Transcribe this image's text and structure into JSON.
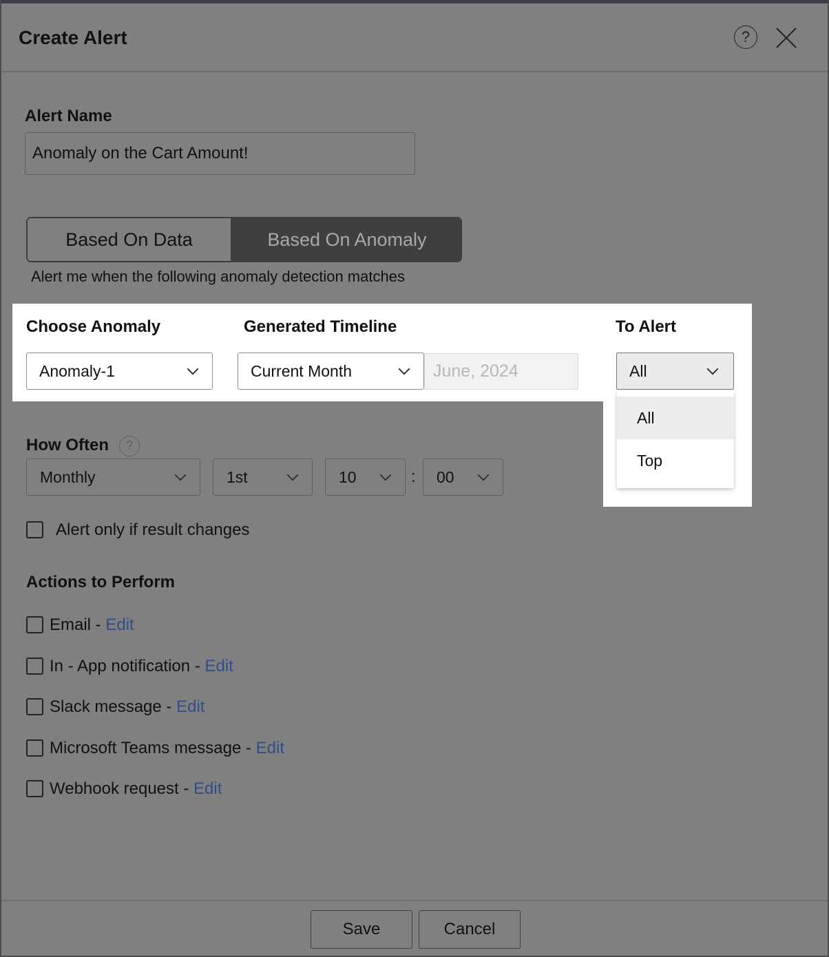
{
  "dialog": {
    "title": "Create Alert",
    "help_icon": "?"
  },
  "alert_name": {
    "label": "Alert Name",
    "value": "Anomaly on the Cart Amount!"
  },
  "mode_toggle": {
    "options": [
      "Based On Data",
      "Based On Anomaly"
    ],
    "selected": "Based On Anomaly"
  },
  "description": "Alert me when the following anomaly detection matches",
  "choose_anomaly": {
    "label": "Choose Anomaly",
    "value": "Anomaly-1"
  },
  "generated_timeline": {
    "label": "Generated Timeline",
    "value": "Current Month",
    "period_placeholder": "June, 2024"
  },
  "to_alert": {
    "label": "To Alert",
    "value": "All",
    "options": [
      "All",
      "Top"
    ],
    "highlighted": "All"
  },
  "how_often": {
    "label": "How Often",
    "help_icon": "?",
    "frequency": "Monthly",
    "day": "1st",
    "hour": "10",
    "separator": ":",
    "minute": "00"
  },
  "alert_on_change": {
    "label": "Alert only if result changes",
    "checked": false
  },
  "actions": {
    "heading": "Actions to Perform",
    "items": [
      {
        "label": "Email - ",
        "edit": "Edit",
        "checked": false
      },
      {
        "label": "In - App notification - ",
        "edit": "Edit",
        "checked": false
      },
      {
        "label": "Slack message - ",
        "edit": "Edit",
        "checked": false
      },
      {
        "label": "Microsoft Teams message - ",
        "edit": "Edit",
        "checked": false
      },
      {
        "label": "Webhook request - ",
        "edit": "Edit",
        "checked": false
      }
    ]
  },
  "footer": {
    "save_label": "Save",
    "cancel_label": "Cancel"
  },
  "colors": {
    "overlay": "#808080",
    "link": "#2e4f8c",
    "toggle_active": "#3f3f3f"
  }
}
